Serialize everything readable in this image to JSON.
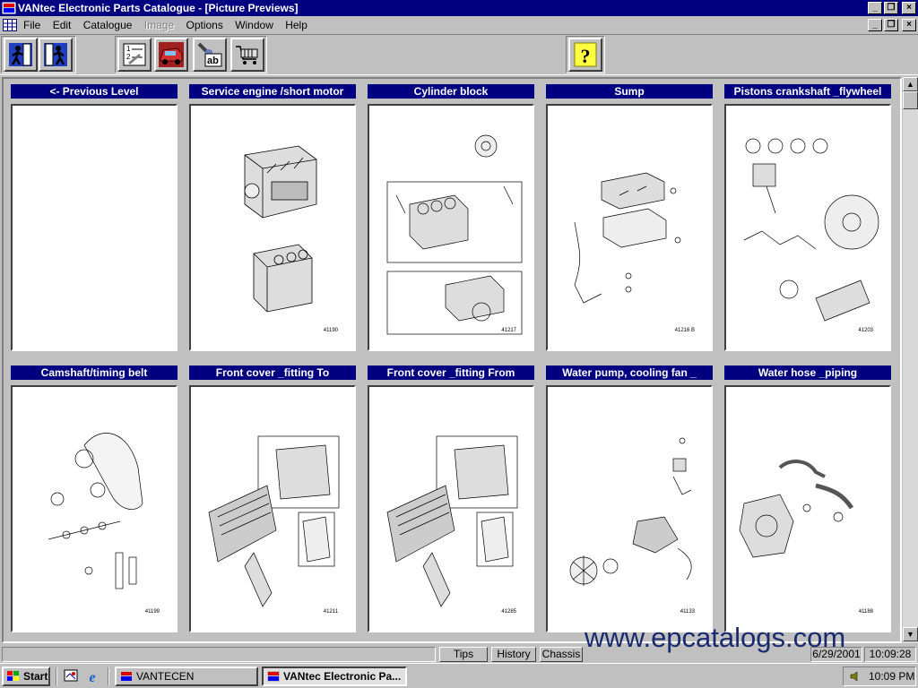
{
  "window": {
    "title": "VANtec Electronic Parts Catalogue - [Picture Previews]",
    "icon": "vantec-app-icon"
  },
  "menu": {
    "items": [
      {
        "label": "File",
        "enabled": true
      },
      {
        "label": "Edit",
        "enabled": true
      },
      {
        "label": "Catalogue",
        "enabled": true
      },
      {
        "label": "Image",
        "enabled": false
      },
      {
        "label": "Options",
        "enabled": true
      },
      {
        "label": "Window",
        "enabled": true
      },
      {
        "label": "Help",
        "enabled": true
      }
    ]
  },
  "toolbar": {
    "buttons": [
      {
        "icon": "exit-person-icon"
      },
      {
        "icon": "back-person-icon"
      },
      {
        "icon": "list-icon"
      },
      {
        "icon": "vehicle-icon"
      },
      {
        "icon": "text-search-icon"
      },
      {
        "icon": "shopping-cart-icon"
      },
      {
        "icon": "help-icon",
        "glyph": "?"
      }
    ]
  },
  "panels": [
    {
      "title": "<- Previous Level",
      "image": "empty",
      "number": ""
    },
    {
      "title": "Service engine /short motor",
      "image": "engine",
      "number": "41190"
    },
    {
      "title": "Cylinder block",
      "image": "cylinder-block",
      "number": "41217"
    },
    {
      "title": "Sump",
      "image": "sump",
      "number": "41216 B"
    },
    {
      "title": "Pistons crankshaft _flywheel",
      "image": "pistons",
      "number": "41203"
    },
    {
      "title": "Camshaft/timing belt",
      "image": "camshaft",
      "number": "41199"
    },
    {
      "title": "Front cover _fitting To",
      "image": "front-cover",
      "number": "41211"
    },
    {
      "title": "Front cover _fitting From",
      "image": "front-cover",
      "number": "41285"
    },
    {
      "title": "Water pump, cooling fan _",
      "image": "water-pump",
      "number": "41133"
    },
    {
      "title": "Water hose _piping",
      "image": "water-hose",
      "number": "41188"
    }
  ],
  "status": {
    "tips": "Tips",
    "history": "History",
    "chassis": "Chassis",
    "date": "6/29/2001",
    "time": "10:09:28"
  },
  "watermark": "www.epcatalogs.com",
  "taskbar": {
    "start": "Start",
    "tasks": [
      {
        "label": "VANTECEN",
        "active": false
      },
      {
        "label": "VANtec Electronic Pa...",
        "active": true
      }
    ],
    "clock": "10:09 PM"
  },
  "colors": {
    "titlebar": "#000080",
    "panel_header": "#000080",
    "face": "#c0c0c0"
  }
}
